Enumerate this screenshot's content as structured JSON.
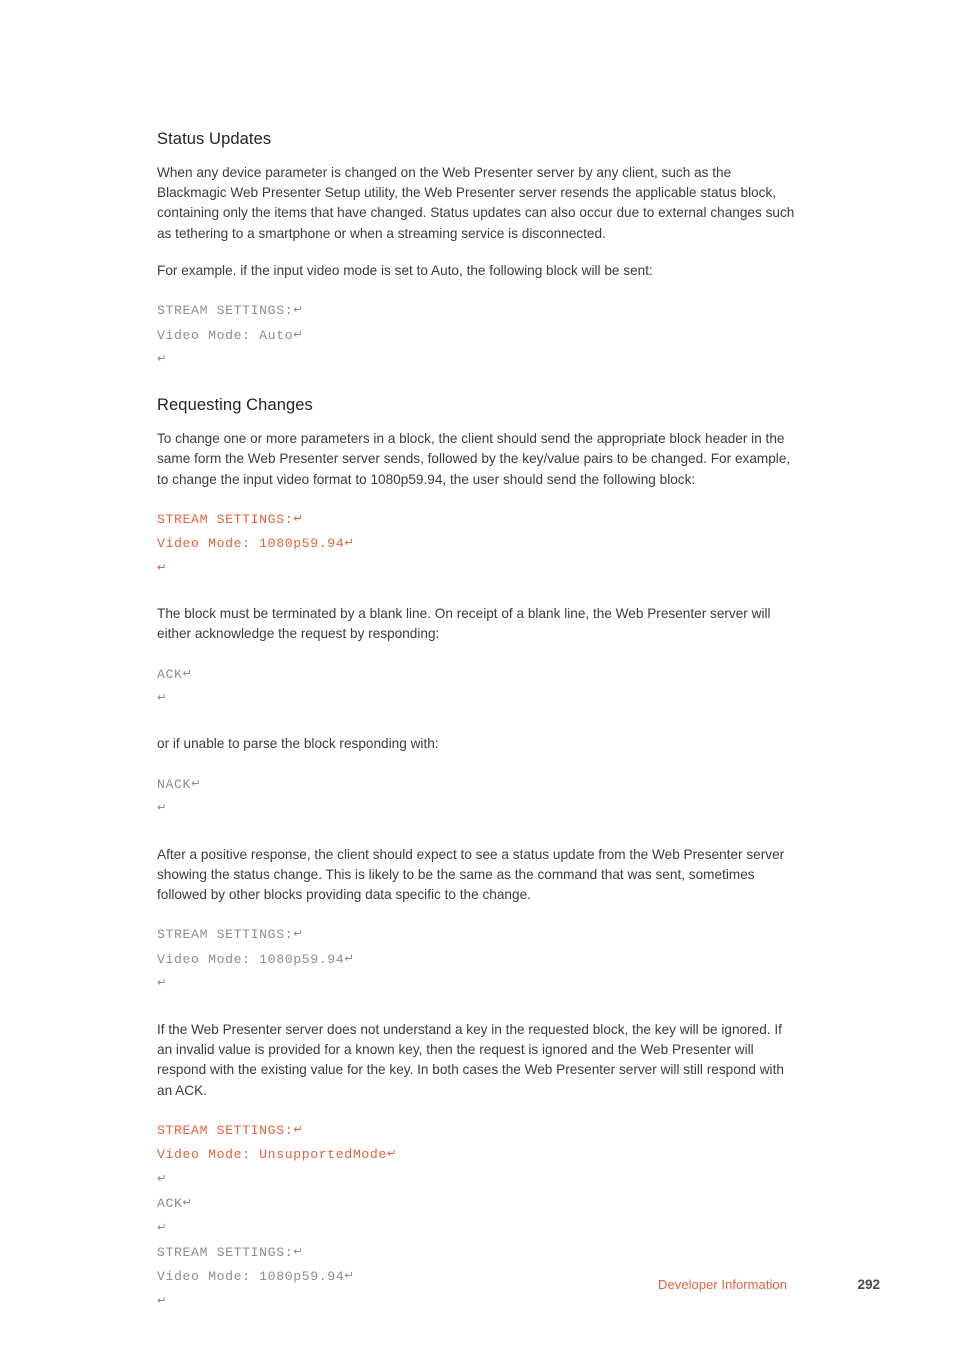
{
  "document": {
    "sections": [
      {
        "heading": "Status Updates",
        "paragraphs": [
          "When any device parameter is changed on the Web Presenter server by any client, such as the Blackmagic Web Presenter Setup utility, the Web Presenter server resends the applicable status block, containing only the items that have changed. Status updates can also occur due to external changes such as tethering to a smartphone or when a streaming service is disconnected.",
          "For example. if the input video mode is set to Auto, the following block will be sent:"
        ],
        "code_block": {
          "color": "#8d8d8d",
          "lines": [
            "STREAM SETTINGS:",
            "Video Mode: Auto",
            ""
          ]
        }
      },
      {
        "heading": "Requesting Changes",
        "paragraphs": [
          "To change one or more parameters in a block, the client should send the appropriate block header in the same form the Web Presenter server sends, followed by the key/value pairs to be changed. For example, to change the input video format to 1080p59.94, the user should send the following block:"
        ],
        "code_block": {
          "color": "#e4633c",
          "lines": [
            "STREAM SETTINGS:",
            "Video Mode: 1080p59.94",
            ""
          ]
        }
      }
    ],
    "blocks": [
      {
        "paragraph": "The block must be terminated by a blank line. On receipt of a blank line, the Web Presenter server will either acknowledge the request by responding:",
        "code": {
          "color": "#8d8d8d",
          "lines": [
            "ACK",
            ""
          ]
        }
      },
      {
        "paragraph": "or if unable to parse the block responding with:",
        "code": {
          "color": "#8d8d8d",
          "lines": [
            "NACK",
            ""
          ]
        }
      },
      {
        "paragraph": "After a positive response, the client should expect to see a status update from the Web Presenter server showing the status change. This is likely to be the same as the command that was sent, sometimes followed by other blocks providing data specific to the change.",
        "code": {
          "color": "#8d8d8d",
          "lines": [
            "STREAM SETTINGS:",
            "Video Mode: 1080p59.94",
            ""
          ]
        }
      },
      {
        "paragraph": "If the Web Presenter server does not understand a key in the requested block, the key will be ignored. If an invalid value is provided for a known key, then the request is ignored and the Web Presenter will respond with the existing value for the key. In both cases the Web Presenter server will still respond with an ACK.",
        "code": {
          "color": "#e4633c",
          "lines": [
            "STREAM SETTINGS:",
            "Video Mode: UnsupportedMode",
            ""
          ]
        }
      },
      {
        "paragraph": "",
        "code": {
          "color": "#8d8d8d",
          "lines": [
            "ACK",
            "",
            "STREAM SETTINGS:",
            "Video Mode: 1080p59.94",
            ""
          ]
        }
      }
    ],
    "carriage_return_symbol": "↵"
  },
  "footer": {
    "label": "Developer Information",
    "page_number": "292"
  },
  "colors": {
    "accent_orange": "#e4633c",
    "body_text": "#3c3c3c",
    "heading": "#242424",
    "code_gray": "#8d8d8d",
    "page_number": "#4a4a4a",
    "background": "#ffffff"
  }
}
